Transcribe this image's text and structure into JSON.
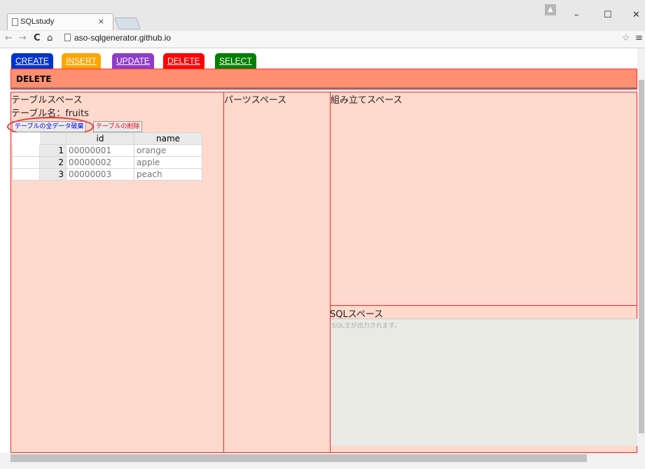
{
  "browser": {
    "tab_title": "SQLstudy",
    "tab_close": "×",
    "url": "aso-sqlgenerator.github.io",
    "window_controls": [
      "–",
      "☐",
      "✕"
    ],
    "nav_icons": [
      "back-arrow-icon",
      "forward-arrow-icon",
      "reload-icon",
      "home-icon"
    ]
  },
  "menu": [
    {
      "label": "CREATE",
      "color": "#0033cc"
    },
    {
      "label": "INSERT",
      "color": "#ffa500"
    },
    {
      "label": "UPDATE",
      "color": "#8e3ccb"
    },
    {
      "label": "DELETE",
      "color": "#ff0000"
    },
    {
      "label": "SELECT",
      "color": "#008000"
    }
  ],
  "header": {
    "title": "DELETE"
  },
  "table_space": {
    "title": "テーブルスペース",
    "table_name": "テーブル名：fruits",
    "btn_truncate": "テーブルの全データ破棄",
    "btn_drop": "テーブルの削除",
    "columns": [
      "",
      "",
      "id",
      "name"
    ],
    "rows": [
      [
        "",
        "1",
        "00000001",
        "orange"
      ],
      [
        "",
        "2",
        "00000002",
        "apple"
      ],
      [
        "",
        "3",
        "00000003",
        "peach"
      ]
    ]
  },
  "parts_space": {
    "title": "パーツスペース"
  },
  "build_space": {
    "title": "組み立てスペース"
  },
  "sql_space": {
    "title": "SQLスペース",
    "placeholder": "SQL文が出力されます。"
  }
}
